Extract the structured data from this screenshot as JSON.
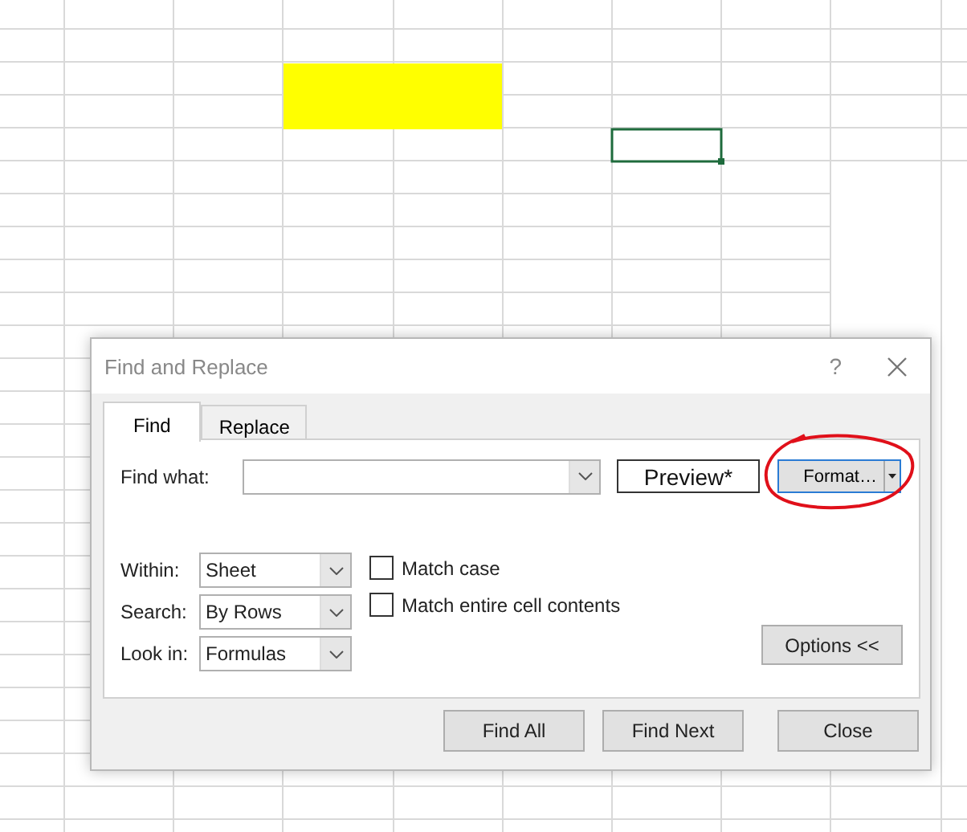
{
  "window": {
    "title": "Find and Replace",
    "help": "?"
  },
  "tabs": [
    {
      "label": "Find",
      "selected": true
    },
    {
      "label": "Replace",
      "selected": false
    }
  ],
  "find_what": {
    "label": "Find what:"
  },
  "preview": "Preview*",
  "format_button": {
    "label": "Format…",
    "annotated": true
  },
  "dropdowns": [
    {
      "label": "Within:",
      "value": "Sheet"
    },
    {
      "label": "Search:",
      "value": "By Rows"
    },
    {
      "label": "Look in:",
      "value": "Formulas"
    }
  ],
  "checkboxes": [
    {
      "label": "Match case",
      "checked": false
    },
    {
      "label": "Match entire cell contents",
      "checked": false
    }
  ],
  "options_button": "Options <<",
  "buttons": [
    "Find All",
    "Find Next",
    "Close"
  ]
}
